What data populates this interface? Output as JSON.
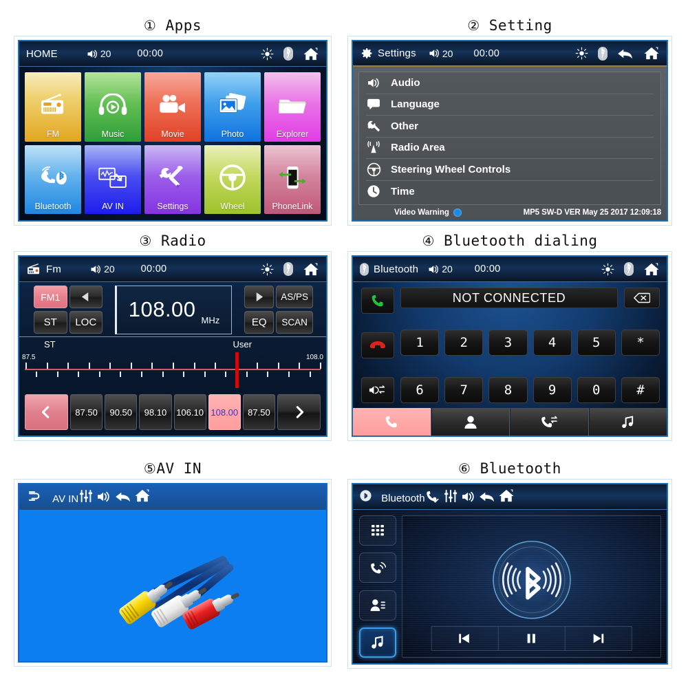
{
  "panels": [
    {
      "number": "①",
      "title": "Apps",
      "statusbar": {
        "title": "HOME",
        "volume": "20",
        "clock": "00:00",
        "icons": [
          "brightness-icon",
          "bluetooth-icon",
          "home-icon"
        ]
      },
      "tiles": [
        {
          "label": "FM",
          "icon": "radio-icon",
          "c1": "#f3e2a8",
          "c2": "#e0a31b"
        },
        {
          "label": "Music",
          "icon": "headphones-icon",
          "c1": "#9ddc82",
          "c2": "#34a83c"
        },
        {
          "label": "Movie",
          "icon": "camcorder-icon",
          "c1": "#f0948a",
          "c2": "#e04a32"
        },
        {
          "label": "Photo",
          "icon": "photo-icon",
          "c1": "#7fc6f5",
          "c2": "#1277e0"
        },
        {
          "label": "Explorer",
          "icon": "folder-icon",
          "c1": "#f0b6e8",
          "c2": "#e03ce0"
        },
        {
          "label": "Bluetooth",
          "icon": "bt-phone-icon",
          "c1": "#a9d6f2",
          "c2": "#2a8fe0"
        },
        {
          "label": "AV IN",
          "icon": "avin-icon",
          "c1": "#8f9ef0",
          "c2": "#2020ef"
        },
        {
          "label": "Settings",
          "icon": "tools-icon",
          "c1": "#b49ceb",
          "c2": "#8a3ce0"
        },
        {
          "label": "Wheel",
          "icon": "wheel-icon",
          "c1": "#dbe89c",
          "c2": "#9ec32a"
        },
        {
          "label": "PhoneLink",
          "icon": "phonelink-icon",
          "c1": "#dca8bc",
          "c2": "#c2607f"
        }
      ]
    },
    {
      "number": "②",
      "title": "Setting",
      "statusbar": {
        "title": "Settings",
        "volume": "20",
        "clock": "00:00",
        "icons": [
          "brightness-icon",
          "bluetooth-icon",
          "back-icon",
          "home-icon"
        ]
      },
      "items": [
        {
          "label": "Audio",
          "icon": "speaker-icon"
        },
        {
          "label": "Language",
          "icon": "chat-icon"
        },
        {
          "label": "Other",
          "icon": "wrench-icon"
        },
        {
          "label": "Radio Area",
          "icon": "antenna-icon"
        },
        {
          "label": "Steering Wheel Controls",
          "icon": "steering-icon"
        },
        {
          "label": "Time",
          "icon": "clock-icon"
        }
      ],
      "footer": {
        "video_warning": "Video Warning",
        "version": "MP5 SW-D VER May 25 2017 12:09:18"
      }
    },
    {
      "number": "③",
      "title": "Radio",
      "statusbar": {
        "title": "Fm",
        "volume": "20",
        "clock": "00:00",
        "icons": [
          "brightness-icon",
          "bluetooth-icon",
          "home-icon"
        ]
      },
      "controls": {
        "band": "FM1",
        "prev": "prev-icon",
        "next": "next-icon",
        "st": "ST",
        "loc": "LOC",
        "asps": "AS/PS",
        "eq": "EQ",
        "scan": "SCAN"
      },
      "display": {
        "frequency": "108.00",
        "unit": "MHz"
      },
      "scale": {
        "left_label": "ST",
        "right_label": "User",
        "min": "87.5",
        "max": "108.0",
        "cursor_pct": 70.5
      },
      "presets": [
        "87.50",
        "90.50",
        "98.10",
        "106.10",
        "108.00",
        "87.50"
      ],
      "active_preset_index": 4,
      "nav_prev": "chevron-left-icon",
      "nav_next": "chevron-right-icon"
    },
    {
      "number": "④",
      "title": "Bluetooth dialing",
      "statusbar": {
        "title": "Bluetooth",
        "volume": "20",
        "clock": "00:00",
        "icons": [
          "brightness-icon",
          "bluetooth-icon",
          "home-icon"
        ]
      },
      "display_text": "NOT CONNECTED",
      "delete_icon": "backspace-icon",
      "side_buttons": [
        "call-answer-icon",
        "call-end-icon",
        "audio-transfer-icon"
      ],
      "keys_row1": [
        "1",
        "2",
        "3",
        "4",
        "5",
        "*"
      ],
      "keys_row2": [
        "6",
        "7",
        "8",
        "9",
        "0",
        "#"
      ],
      "tabs": [
        "dialpad-tab-icon",
        "contacts-tab-icon",
        "callhistory-tab-icon",
        "btmusic-tab-icon"
      ],
      "selected_tab": 0
    },
    {
      "number": "⑤",
      "title": "AV IN",
      "statusbar": {
        "title": "AV IN",
        "icons": [
          "equalizer-icon",
          "speaker-icon",
          "back-icon",
          "home-icon"
        ]
      },
      "content": "av-rca-cables-image"
    },
    {
      "number": "⑥",
      "title": "Bluetooth",
      "statusbar": {
        "title": "Bluetooth",
        "icons": [
          "phone-icon",
          "equalizer-icon",
          "speaker-icon",
          "back-icon",
          "home-icon"
        ]
      },
      "side_buttons": [
        "keypad-icon",
        "phone-waves-icon",
        "contacts-icon",
        "music-note-icon"
      ],
      "selected_side_index": 3,
      "logo": "bluetooth-logo",
      "transport": [
        "prev-track-icon",
        "pause-icon",
        "next-track-icon"
      ]
    }
  ]
}
